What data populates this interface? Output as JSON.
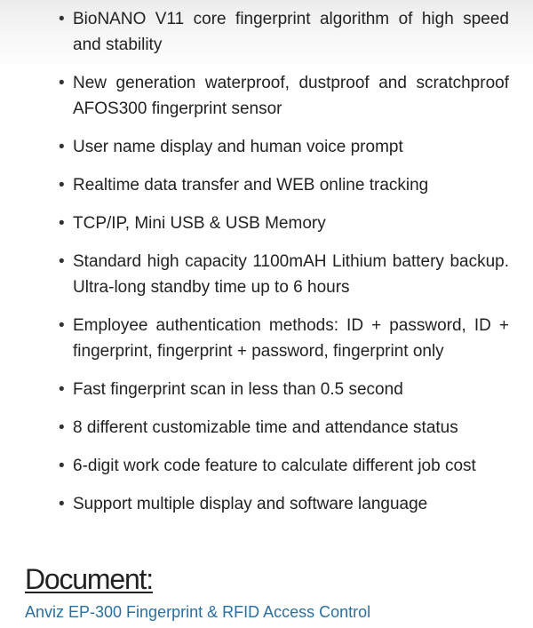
{
  "features": [
    "BioNANO V11 core fingerprint algorithm of high speed and stability",
    "New generation waterproof, dustproof and scratchproof AFOS300 fingerprint sensor",
    "User name display and human voice prompt",
    "Realtime data transfer and WEB online tracking",
    "TCP/IP, Mini USB & USB Memory",
    "Standard high capacity 1100mAH Lithium battery backup. Ultra-long standby time up to 6 hours",
    "Employee authentication methods: ID + password, ID + fingerprint, fingerprint + password, fingerprint only",
    "Fast fingerprint scan in less than 0.5 second",
    "8 different customizable time and attendance status",
    "6-digit work code feature to calculate different job cost",
    "Support multiple display and software language"
  ],
  "bullet_glyph": "•",
  "document": {
    "heading": "Document:",
    "link_text": "Anviz EP-300 Fingerprint & RFID Access Control",
    "link_color": "#2b6f9e"
  }
}
